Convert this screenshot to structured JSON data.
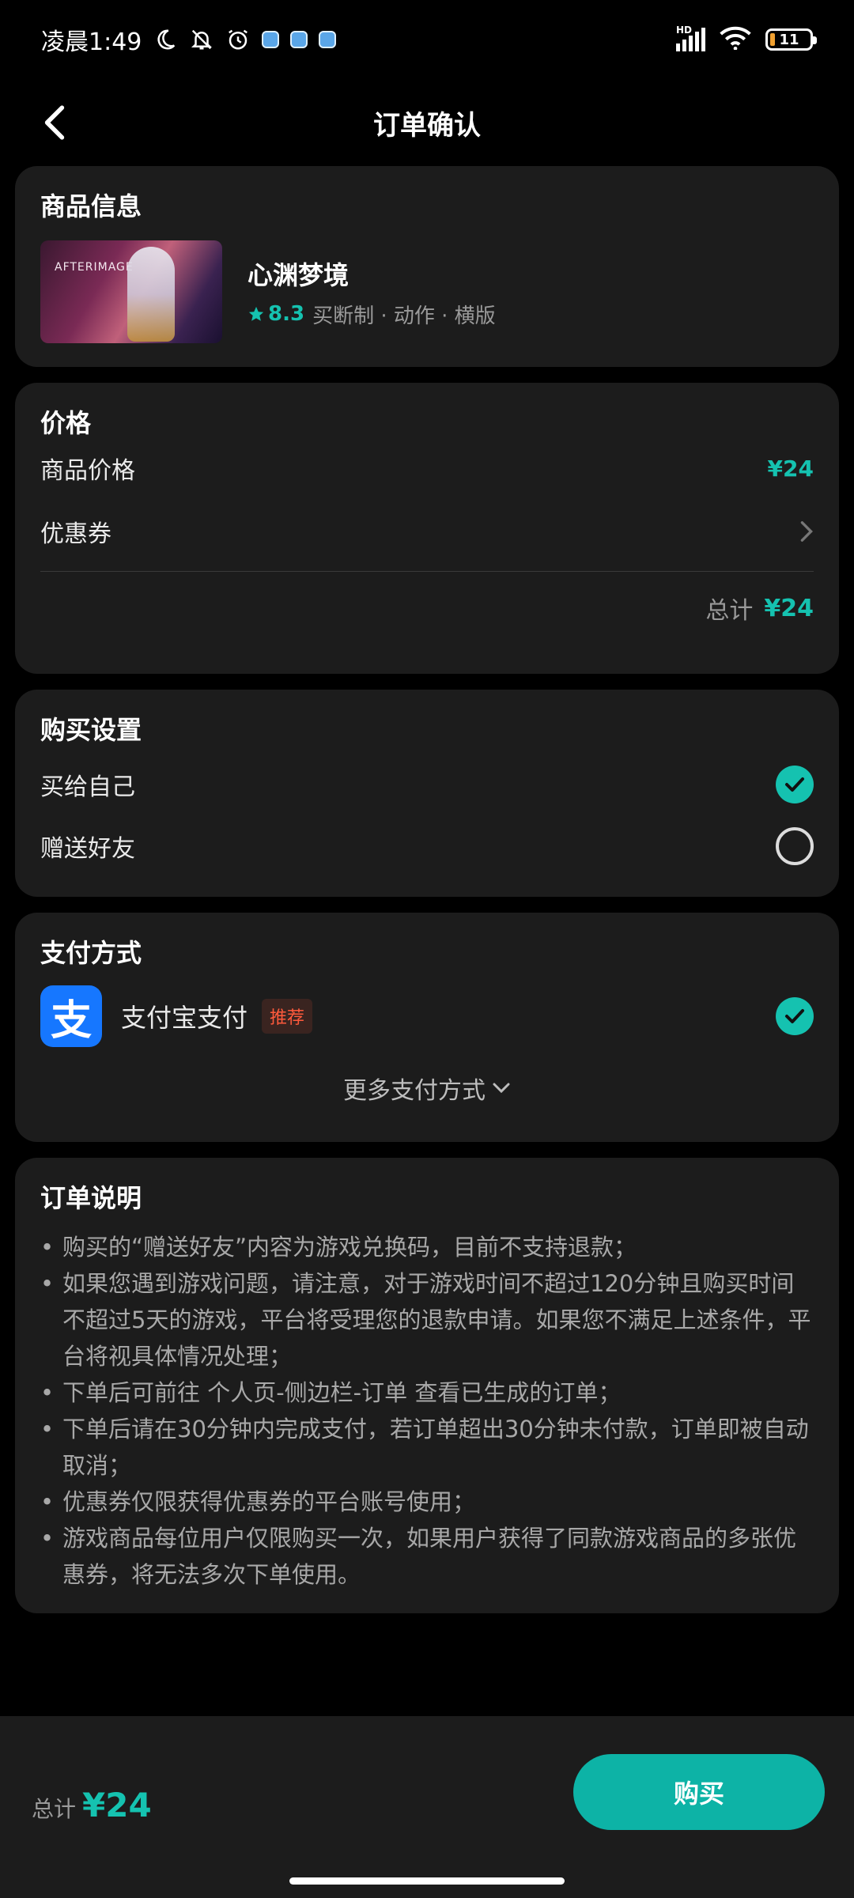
{
  "status_bar": {
    "time": "凌晨1:49",
    "network_label": "HD",
    "battery": "11"
  },
  "nav": {
    "title": "订单确认"
  },
  "product_card": {
    "title": "商品信息",
    "thumb_text": "AFTERIMAGE",
    "name": "心渊梦境",
    "rating": "8.3",
    "tags": "买断制 · 动作 · 横版"
  },
  "price_card": {
    "title": "价格",
    "product_price_label": "商品价格",
    "product_price_value": "¥24",
    "coupon_label": "优惠券",
    "total_label": "总计",
    "total_value": "¥24"
  },
  "purchase_card": {
    "title": "购买设置",
    "options": [
      {
        "label": "买给自己",
        "selected": true
      },
      {
        "label": "赠送好友",
        "selected": false
      }
    ]
  },
  "payment_card": {
    "title": "支付方式",
    "method_icon_glyph": "支",
    "method_name": "支付宝支付",
    "method_badge": "推荐",
    "more_label": "更多支付方式"
  },
  "notes_card": {
    "title": "订单说明",
    "items": [
      "购买的“赠送好友”内容为游戏兑换码，目前不支持退款；",
      "如果您遇到游戏问题，请注意，对于游戏时间不超过120分钟且购买时间不超过5天的游戏，平台将受理您的退款申请。如果您不满足上述条件，平台将视具体情况处理；",
      "下单后可前往 个人页-侧边栏-订单 查看已生成的订单；",
      "下单后请在30分钟内完成支付，若订单超出30分钟未付款，订单即被自动取消；",
      "优惠券仅限获得优惠券的平台账号使用；",
      "游戏商品每位用户仅限购买一次，如果用户获得了同款游戏商品的多张优惠券，将无法多次下单使用。"
    ]
  },
  "bottom_bar": {
    "total_label": "总计",
    "total_value": "¥24",
    "buy_label": "购买"
  },
  "colors": {
    "accent": "#15c2b0",
    "card_bg": "#1c1c1c",
    "page_bg": "#000000",
    "alipay_blue": "#1677ff",
    "badge_red": "#ff5a3c"
  }
}
